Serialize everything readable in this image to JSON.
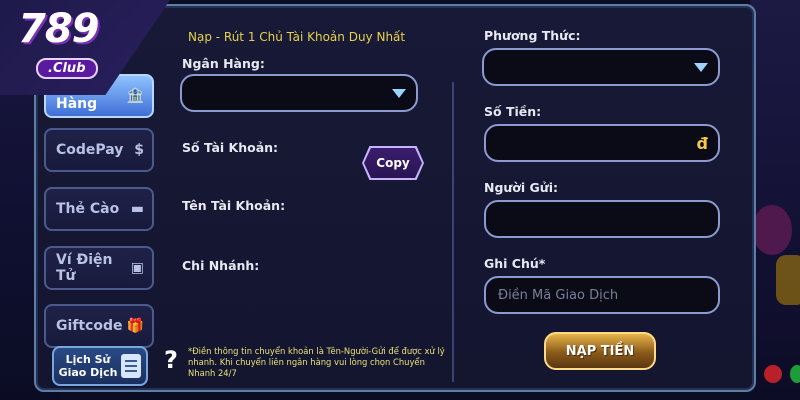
{
  "brand": {
    "number": "789",
    "club": ".Club"
  },
  "sidebar": {
    "items": [
      {
        "label": "Ngân Hàng",
        "icon": "bank-icon",
        "active": true
      },
      {
        "label": "CodePay",
        "icon": "coin-icon",
        "active": false
      },
      {
        "label": "Thẻ Cào",
        "icon": "card-icon",
        "active": false
      },
      {
        "label": "Ví Điện Tử",
        "icon": "wallet-icon",
        "active": false
      },
      {
        "label": "Giftcode",
        "icon": "gift-icon",
        "active": false
      }
    ],
    "history_line1": "Lịch Sử",
    "history_line2": "Giao Dịch"
  },
  "left_form": {
    "note": "Nạp - Rút 1 Chủ Tài Khoản Duy Nhất",
    "bank_label": "Ngân Hàng:",
    "bank_value": "",
    "account_number_label": "Số Tài Khoản:",
    "copy_label": "Copy",
    "account_name_label": "Tên Tài Khoản:",
    "branch_label": "Chi Nhánh:",
    "help_text": "*Điền thông tin chuyển khoản là Tên-Người-Gửi để được xử lý nhanh. Khi chuyển liên ngân hàng vui lòng chọn Chuyển Nhanh 24/7"
  },
  "right_form": {
    "method_label": "Phương Thức:",
    "method_value": "",
    "amount_label": "Số Tiền:",
    "amount_currency": "đ",
    "sender_label": "Người Gửi:",
    "sender_value": "",
    "note_label": "Ghi Chú*",
    "note_placeholder": "Điền Mã Giao Dịch",
    "submit_label": "NẠP TIỀN"
  },
  "colors": {
    "accent_note": "#e6d24a",
    "active_tab": "#3f6fd6",
    "submit_gold": "#e8b44a",
    "field_border": "#8c9ad0"
  }
}
